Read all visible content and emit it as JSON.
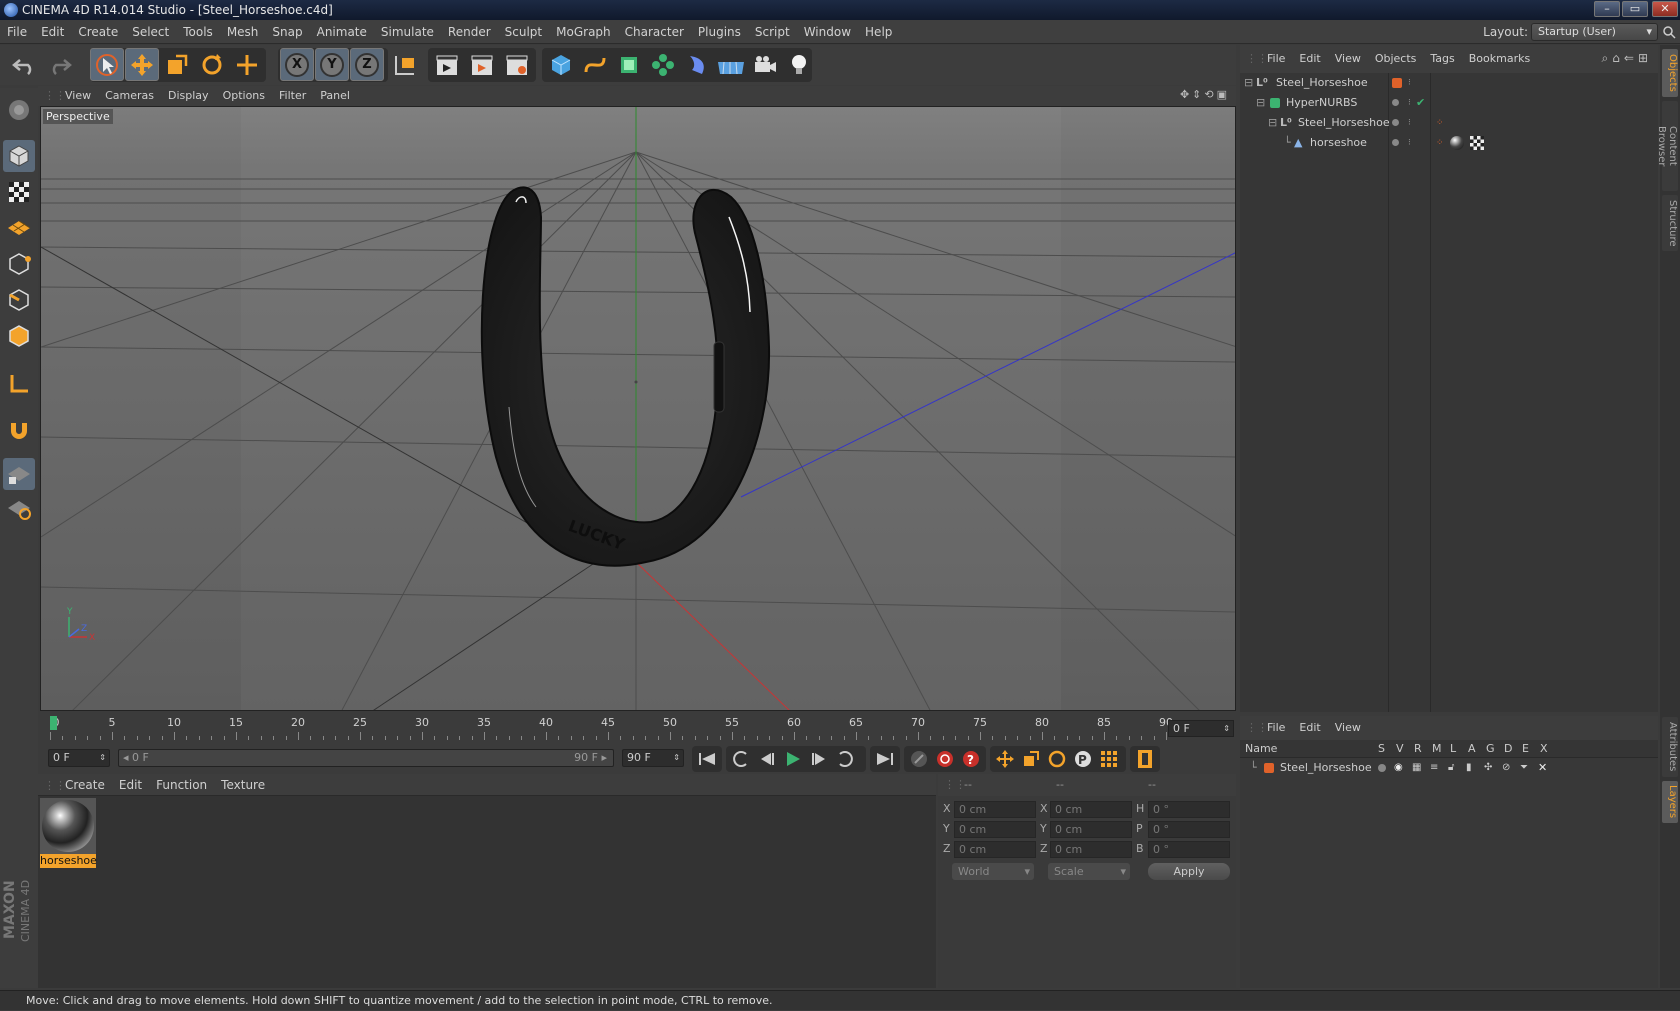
{
  "window": {
    "title": "CINEMA 4D R14.014 Studio - [Steel_Horseshoe.c4d]",
    "controls": [
      "–",
      "▭",
      "✕"
    ]
  },
  "menubar": {
    "items": [
      "File",
      "Edit",
      "Create",
      "Select",
      "Tools",
      "Mesh",
      "Snap",
      "Animate",
      "Simulate",
      "Render",
      "Sculpt",
      "MoGraph",
      "Character",
      "Plugins",
      "Script",
      "Window",
      "Help"
    ],
    "layout_label": "Layout:",
    "layout_value": "Startup (User)"
  },
  "toolbar": {
    "axis_x": "X",
    "axis_y": "Y",
    "axis_z": "Z"
  },
  "viewport": {
    "menu": [
      "View",
      "Cameras",
      "Display",
      "Options",
      "Filter",
      "Panel"
    ],
    "camera_label": "Perspective",
    "model_text": "LUCKY",
    "axis_y": "Y",
    "axis_x": "X",
    "axis_z": "Z"
  },
  "timeline": {
    "ticks": [
      "0",
      "5",
      "10",
      "15",
      "20",
      "25",
      "30",
      "35",
      "40",
      "45",
      "50",
      "55",
      "60",
      "65",
      "70",
      "75",
      "80",
      "85",
      "90"
    ],
    "current_frame": "0 F"
  },
  "transport": {
    "start_frame": "0 F",
    "range_start": "◂ 0 F",
    "range_end": "90 F ▸",
    "end_frame": "90 F"
  },
  "material_manager": {
    "menu": [
      "Create",
      "Edit",
      "Function",
      "Texture"
    ],
    "materials": [
      {
        "name": "horseshoe"
      }
    ]
  },
  "coordinates": {
    "headers": [
      "--",
      "--",
      "--"
    ],
    "rows": [
      {
        "pos_label": "X",
        "pos_value": "0 cm",
        "size_label": "X",
        "size_value": "0 cm",
        "rot_label": "H",
        "rot_value": "0 °"
      },
      {
        "pos_label": "Y",
        "pos_value": "0 cm",
        "size_label": "Y",
        "size_value": "0 cm",
        "rot_label": "P",
        "rot_value": "0 °"
      },
      {
        "pos_label": "Z",
        "pos_value": "0 cm",
        "size_label": "Z",
        "size_value": "0 cm",
        "rot_label": "B",
        "rot_value": "0 °"
      }
    ],
    "space_select": "World",
    "mode_select": "Scale",
    "apply_label": "Apply"
  },
  "object_manager": {
    "menu": [
      "File",
      "Edit",
      "View",
      "Objects",
      "Tags",
      "Bookmarks"
    ],
    "objects": [
      {
        "name": "Steel_Horseshoe"
      },
      {
        "name": "HyperNURBS"
      },
      {
        "name": "Steel_Horseshoe"
      },
      {
        "name": "horseshoe"
      }
    ]
  },
  "layer_manager": {
    "menu": [
      "File",
      "Edit",
      "View"
    ],
    "columns": [
      "Name",
      "S",
      "V",
      "R",
      "M",
      "L",
      "A",
      "G",
      "D",
      "E",
      "X"
    ],
    "layers": [
      {
        "name": "Steel_Horseshoe",
        "color": "#e0622a"
      }
    ]
  },
  "side_tabs": {
    "top": [
      "Objects",
      "Content Browser",
      "Structure"
    ],
    "bottom": [
      "Attributes",
      "Layers"
    ]
  },
  "status": {
    "text": "Move: Click and drag to move elements. Hold down SHIFT to quantize movement / add to the selection in point mode, CTRL to remove."
  },
  "branding": {
    "maxon": "MAXON",
    "product": "CINEMA 4D"
  },
  "colors": {
    "accent_orange": "#f3a32b",
    "selected_blue": "#5b6a7a",
    "layer_orange": "#e0622a",
    "title_blue": "#1d2a44"
  }
}
